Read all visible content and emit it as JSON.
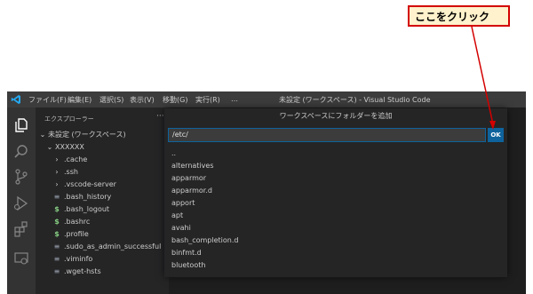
{
  "callout": {
    "text": "ここをクリック",
    "border_color": "#d40000",
    "fill_color": "#fff2cc"
  },
  "titlebar": {
    "menus": [
      "ファイル(F)",
      "編集(E)",
      "選択(S)",
      "表示(V)",
      "移動(G)",
      "実行(R)",
      "…"
    ],
    "window_title": "未設定 (ワークスペース) - Visual Studio Code"
  },
  "activity_icons": [
    "explorer-icon",
    "search-icon",
    "source-control-icon",
    "run-debug-icon",
    "extensions-icon",
    "remote-explorer-icon"
  ],
  "sidebar": {
    "title": "エクスプローラー",
    "more": "···",
    "workspace": "未設定 (ワークスペース)",
    "folder": "XXXXXX",
    "items": [
      {
        "label": ".cache",
        "icon": "chevron-right-icon",
        "glyph": "›"
      },
      {
        "label": ".ssh",
        "icon": "chevron-right-icon",
        "glyph": "›"
      },
      {
        "label": ".vscode-server",
        "icon": "chevron-right-icon",
        "glyph": "›"
      },
      {
        "label": ".bash_history",
        "icon": "text-file-icon",
        "glyph": "≡"
      },
      {
        "label": ".bash_logout",
        "icon": "shell-file-icon",
        "glyph": "$"
      },
      {
        "label": ".bashrc",
        "icon": "shell-file-icon",
        "glyph": "$"
      },
      {
        "label": ".profile",
        "icon": "shell-file-icon",
        "glyph": "$"
      },
      {
        "label": ".sudo_as_admin_successful",
        "icon": "text-file-icon",
        "glyph": "≡"
      },
      {
        "label": ".viminfo",
        "icon": "text-file-icon",
        "glyph": "≡"
      },
      {
        "label": ".wget-hsts",
        "icon": "text-file-icon",
        "glyph": "≡"
      }
    ]
  },
  "dialog": {
    "title": "ワークスペースにフォルダーを追加",
    "input_value": "/etc/",
    "ok_label": "OK",
    "items": [
      "..",
      "alternatives",
      "apparmor",
      "apparmor.d",
      "apport",
      "apt",
      "avahi",
      "bash_completion.d",
      "binfmt.d",
      "bluetooth"
    ]
  },
  "colors": {
    "accent": "#0e639c",
    "sidebar_bg": "#252526",
    "editor_bg": "#1e1e1e",
    "titlebar_bg": "#3c3c3c"
  }
}
